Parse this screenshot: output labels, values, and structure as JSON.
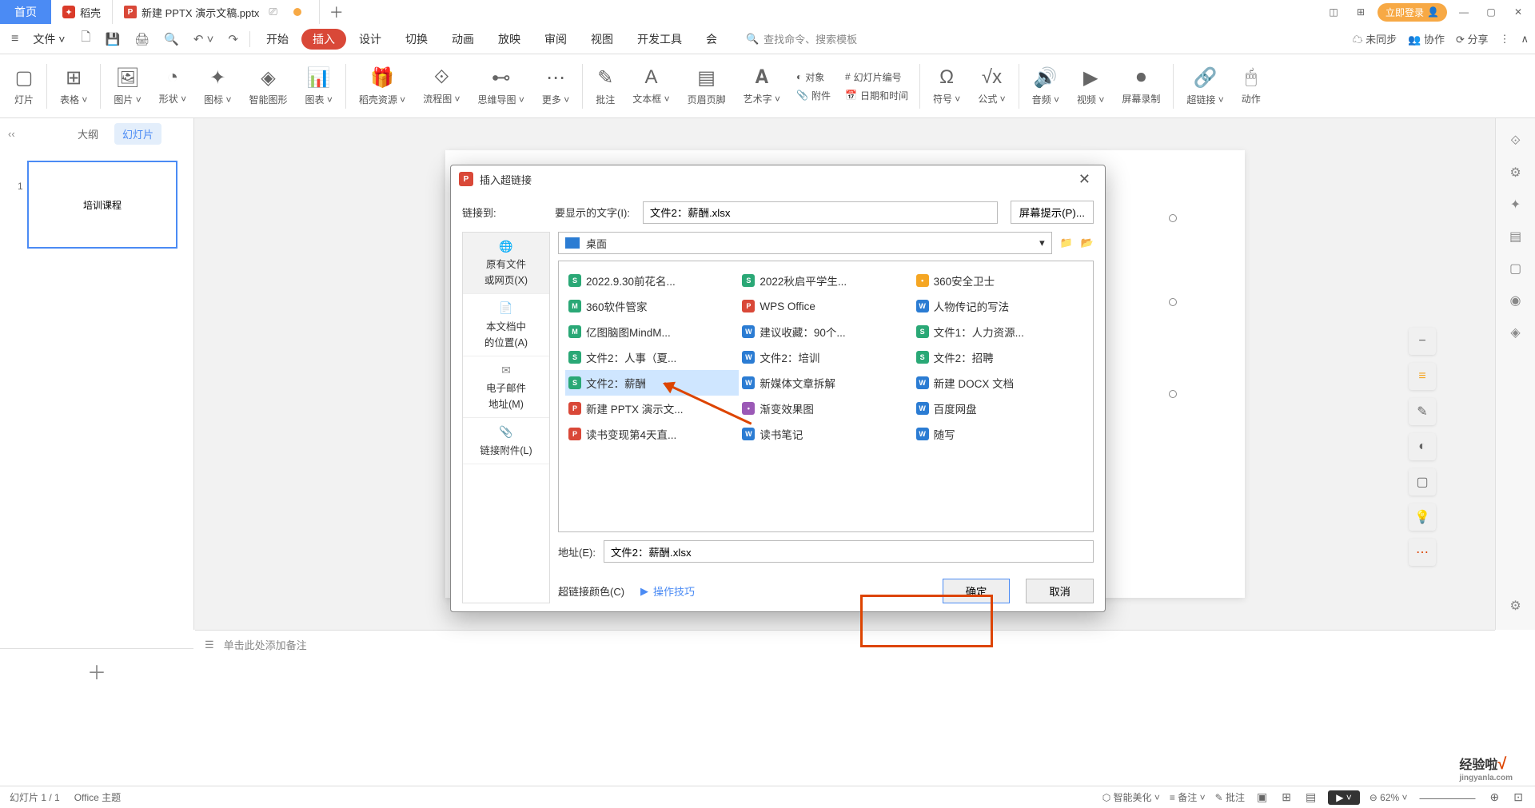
{
  "titlebar": {
    "home": "首页",
    "doke": "稻壳",
    "file": "新建 PPTX 演示文稿.pptx",
    "add": "＋",
    "login": "立即登录"
  },
  "menu": {
    "file": "文件",
    "tabs": [
      "开始",
      "插入",
      "设计",
      "切换",
      "动画",
      "放映",
      "审阅",
      "视图",
      "开发工具",
      "会"
    ],
    "active_index": 1,
    "search_hint": "查找命令、搜索模板",
    "unsync": "未同步",
    "collab": "协作",
    "share": "分享"
  },
  "ribbon": {
    "items": [
      "灯片",
      "表格",
      "图片",
      "形状",
      "图标",
      "智能图形",
      "图表",
      "稻壳资源",
      "流程图",
      "思维导图",
      "更多",
      "批注",
      "文本框",
      "页眉页脚",
      "艺术字",
      "符号",
      "公式",
      "音频",
      "视频",
      "屏幕录制",
      "超链接",
      "动作"
    ],
    "stack1": [
      "对象",
      "幻灯片编号"
    ],
    "stack2": [
      "附件",
      "日期和时间"
    ]
  },
  "sidebar": {
    "tabs": [
      "大纲",
      "幻灯片"
    ],
    "slide_num": "1",
    "thumb_text": "培训课程",
    "add": "＋"
  },
  "notes": "单击此处添加备注",
  "statusbar": {
    "slide_info": "幻灯片 1 / 1",
    "theme": "Office 主题",
    "beautify": "智能美化",
    "notes": "备注",
    "comments": "批注",
    "zoom": "62%"
  },
  "dialog": {
    "title": "插入超链接",
    "link_to": "链接到:",
    "display_label": "要显示的文字(I):",
    "display_value": "文件2：薪酬.xlsx",
    "screen_tip": "屏幕提示(P)...",
    "side": {
      "i0": "原有文件\n或网页(X)",
      "i1": "本文档中\n的位置(A)",
      "i2": "电子邮件\n地址(M)",
      "i3": "链接附件(L)"
    },
    "path_label": "桌面",
    "files": [
      {
        "n": "2022.9.30前花名...",
        "c": "ic-s"
      },
      {
        "n": "2022秋启平学生...",
        "c": "ic-s"
      },
      {
        "n": "360安全卫士",
        "c": "ic-o"
      },
      {
        "n": "360软件管家",
        "c": "ic-m"
      },
      {
        "n": "WPS Office",
        "c": "ic-p"
      },
      {
        "n": "人物传记的写法",
        "c": "ic-w"
      },
      {
        "n": "亿图脑图MindM...",
        "c": "ic-m"
      },
      {
        "n": "建议收藏：90个...",
        "c": "ic-w"
      },
      {
        "n": "文件1：人力资源...",
        "c": "ic-s"
      },
      {
        "n": "文件2：人事（夏...",
        "c": "ic-s"
      },
      {
        "n": "文件2：培训",
        "c": "ic-w"
      },
      {
        "n": "文件2：招聘",
        "c": "ic-s"
      },
      {
        "n": "文件2：薪酬",
        "c": "ic-s",
        "sel": true
      },
      {
        "n": "新媒体文章拆解",
        "c": "ic-w"
      },
      {
        "n": "新建 DOCX 文档",
        "c": "ic-w"
      },
      {
        "n": "新建 PPTX 演示文...",
        "c": "ic-p"
      },
      {
        "n": "渐变效果图",
        "c": "ic-r"
      },
      {
        "n": "百度网盘",
        "c": "ic-w"
      },
      {
        "n": "读书变现第4天直...",
        "c": "ic-p"
      },
      {
        "n": "读书笔记",
        "c": "ic-w"
      },
      {
        "n": "随写",
        "c": "ic-w"
      }
    ],
    "addr_label": "地址(E):",
    "addr_value": "文件2：薪酬.xlsx",
    "color_label": "超链接颜色(C)",
    "tip": "操作技巧",
    "ok": "确定",
    "cancel": "取消"
  },
  "watermark": {
    "line1": "经验啦",
    "line2": "jingyanla.com"
  }
}
